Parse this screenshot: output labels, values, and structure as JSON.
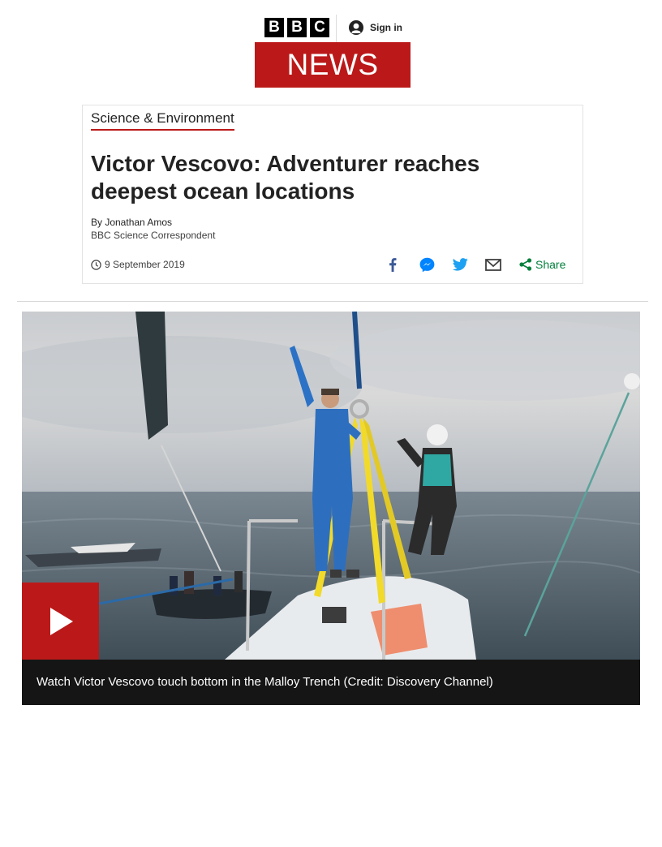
{
  "header": {
    "brand_letters": [
      "B",
      "B",
      "C"
    ],
    "sign_in_label": "Sign in",
    "news_label": "NEWS",
    "icons": {
      "account": "user-account-icon"
    },
    "colors": {
      "brand_red": "#bb1919",
      "block_black": "#000000"
    }
  },
  "article": {
    "section": "Science & Environment",
    "headline": "Victor Vescovo: Adventurer reaches deepest ocean locations",
    "byline": {
      "author": "By Jonathan Amos",
      "role": "BBC Science Correspondent"
    },
    "date": "9 September 2019",
    "share": {
      "icons": [
        "facebook-icon",
        "messenger-icon",
        "twitter-icon",
        "email-icon",
        "share-icon"
      ],
      "share_label": "Share",
      "colors": {
        "facebook": "#3b5998",
        "messenger": "#0084ff",
        "twitter": "#1da1f2",
        "email": "#404040",
        "share": "#007f3b"
      }
    }
  },
  "video": {
    "caption": "Watch Victor Vescovo touch bottom in the Malloy Trench (Credit: Discovery Channel)",
    "play_icon": "play-icon",
    "colors": {
      "play_bg": "#bb1919",
      "caption_bg": "#151515"
    }
  }
}
